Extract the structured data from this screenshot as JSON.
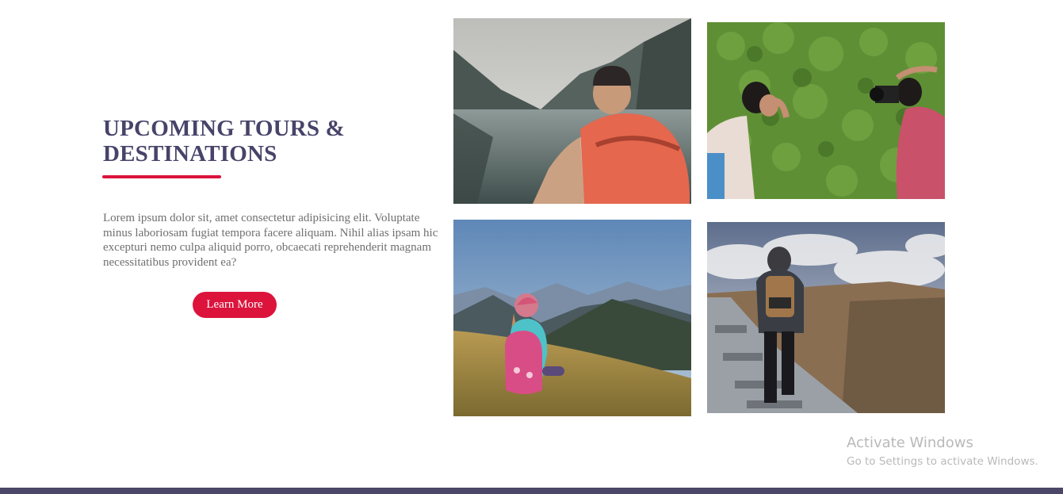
{
  "section": {
    "title": "UPCOMING TOURS & DESTINATIONS",
    "description": "Lorem ipsum dolor sit, amet consectetur adipisicing elit. Voluptate minus laboriosam fugiat tempora facere aliquam. Nihil alias ipsam hic excepturi nemo culpa aliquid porro, obcaecati reprehenderit magnam necessitatibus provident ea?",
    "button_label": "Learn More"
  },
  "gallery": [
    {
      "subject": "hiker with red backpack at mountain lake"
    },
    {
      "subject": "photographers on green ivy wall"
    },
    {
      "subject": "child with pink backpack on mountain meadow"
    },
    {
      "subject": "hiker walking rocky path under cloudy sky"
    }
  ],
  "watermark": {
    "title": "Activate Windows",
    "subtitle": "Go to Settings to activate Windows."
  },
  "colors": {
    "heading": "#474369",
    "accent": "#dc143c",
    "body_text": "#6f6f6f",
    "footer": "#4a4768"
  }
}
